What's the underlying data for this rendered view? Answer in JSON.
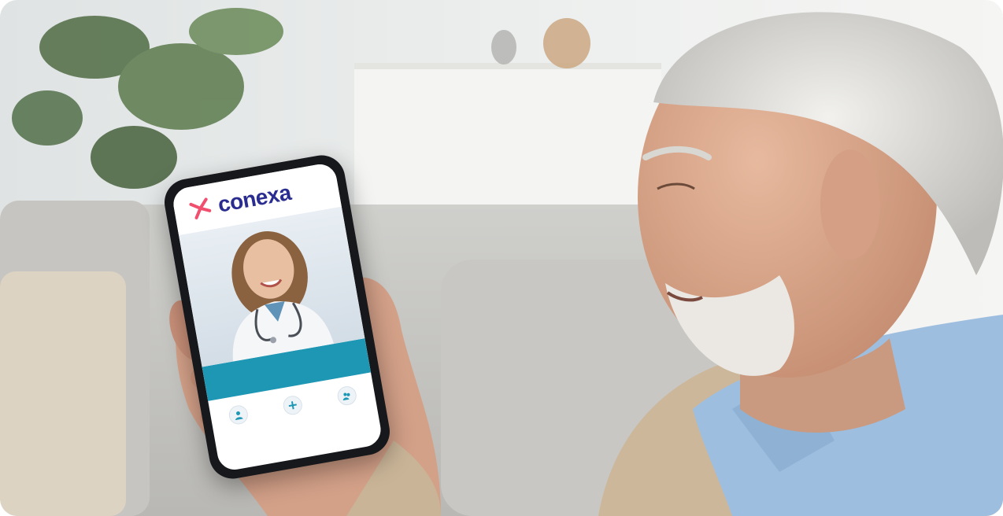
{
  "photo": {
    "subject": "elderly-man-holding-smartphone",
    "scene": "living-room-couch"
  },
  "app": {
    "brand_name": "conexa",
    "brand_color": "#2a2c8f",
    "logo_accent": "#f0506e",
    "banner_color": "#1e97b5",
    "banner_title": "",
    "banner_subtitle": "",
    "actions": [
      {
        "icon": "doctor-icon",
        "label": ""
      },
      {
        "icon": "plus-icon",
        "label": ""
      },
      {
        "icon": "users-icon",
        "label": ""
      }
    ]
  }
}
